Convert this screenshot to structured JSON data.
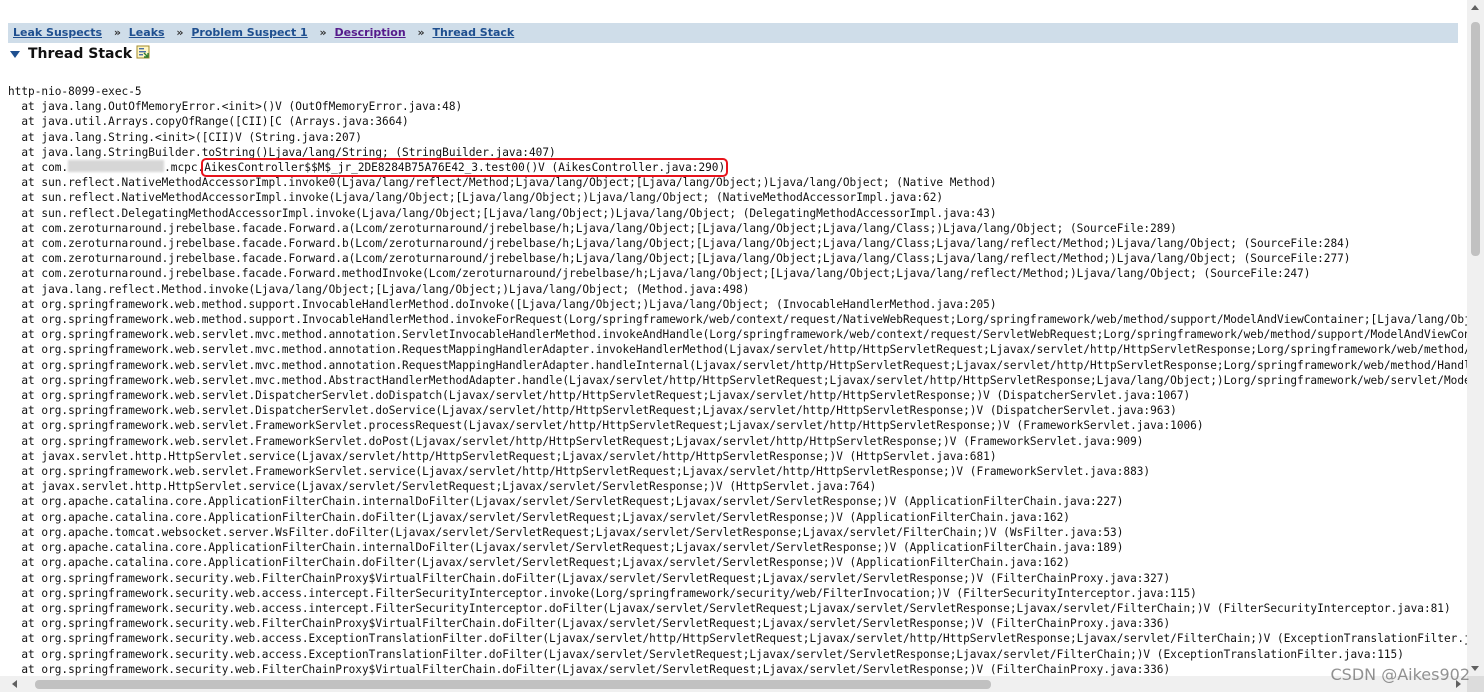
{
  "breadcrumb": {
    "items": [
      "Leak Suspects",
      "Leaks",
      "Problem Suspect 1",
      "Description",
      "Thread Stack"
    ],
    "separator": "»"
  },
  "section": {
    "title": "Thread Stack",
    "toggle_icon": "triangle-down-icon",
    "copy_icon": "copy-icon"
  },
  "stack": {
    "thread_name": "http-nio-8099-exec-5",
    "frames_before_highlight": [
      "  at java.lang.OutOfMemoryError.<init>()V (OutOfMemoryError.java:48)",
      "  at java.util.Arrays.copyOfRange([CII)[C (Arrays.java:3664)",
      "  at java.lang.String.<init>([CII)V (String.java:207)",
      "  at java.lang.StringBuilder.toString()Ljava/lang/String; (StringBuilder.java:407)"
    ],
    "highlight_prefix": "  at com.",
    "highlight_middle": ".mcpc.",
    "highlight_text": "AikesController$$M$_jr_2DE8284B75A76E42_3.test00()V (AikesController.java:290)",
    "frames_after_highlight": [
      "  at sun.reflect.NativeMethodAccessorImpl.invoke0(Ljava/lang/reflect/Method;Ljava/lang/Object;[Ljava/lang/Object;)Ljava/lang/Object; (Native Method)",
      "  at sun.reflect.NativeMethodAccessorImpl.invoke(Ljava/lang/Object;[Ljava/lang/Object;)Ljava/lang/Object; (NativeMethodAccessorImpl.java:62)",
      "  at sun.reflect.DelegatingMethodAccessorImpl.invoke(Ljava/lang/Object;[Ljava/lang/Object;)Ljava/lang/Object; (DelegatingMethodAccessorImpl.java:43)",
      "  at com.zeroturnaround.jrebelbase.facade.Forward.a(Lcom/zeroturnaround/jrebelbase/h;Ljava/lang/Object;[Ljava/lang/Object;Ljava/lang/Class;)Ljava/lang/Object; (SourceFile:289)",
      "  at com.zeroturnaround.jrebelbase.facade.Forward.b(Lcom/zeroturnaround/jrebelbase/h;Ljava/lang/Object;[Ljava/lang/Object;Ljava/lang/Class;Ljava/lang/reflect/Method;)Ljava/lang/Object; (SourceFile:284)",
      "  at com.zeroturnaround.jrebelbase.facade.Forward.a(Lcom/zeroturnaround/jrebelbase/h;Ljava/lang/Object;[Ljava/lang/Object;Ljava/lang/Class;Ljava/lang/reflect/Method;)Ljava/lang/Object; (SourceFile:277)",
      "  at com.zeroturnaround.jrebelbase.facade.Forward.methodInvoke(Lcom/zeroturnaround/jrebelbase/h;Ljava/lang/Object;[Ljava/lang/Object;Ljava/lang/reflect/Method;)Ljava/lang/Object; (SourceFile:247)",
      "  at java.lang.reflect.Method.invoke(Ljava/lang/Object;[Ljava/lang/Object;)Ljava/lang/Object; (Method.java:498)",
      "  at org.springframework.web.method.support.InvocableHandlerMethod.doInvoke([Ljava/lang/Object;)Ljava/lang/Object; (InvocableHandlerMethod.java:205)",
      "  at org.springframework.web.method.support.InvocableHandlerMethod.invokeForRequest(Lorg/springframework/web/context/request/NativeWebRequest;Lorg/springframework/web/method/support/ModelAndViewContainer;[Ljava/lang/Obj",
      "  at org.springframework.web.servlet.mvc.method.annotation.ServletInvocableHandlerMethod.invokeAndHandle(Lorg/springframework/web/context/request/ServletWebRequest;Lorg/springframework/web/method/support/ModelAndViewCon",
      "  at org.springframework.web.servlet.mvc.method.annotation.RequestMappingHandlerAdapter.invokeHandlerMethod(Ljavax/servlet/http/HttpServletRequest;Ljavax/servlet/http/HttpServletResponse;Lorg/springframework/web/method/",
      "  at org.springframework.web.servlet.mvc.method.annotation.RequestMappingHandlerAdapter.handleInternal(Ljavax/servlet/http/HttpServletRequest;Ljavax/servlet/http/HttpServletResponse;Lorg/springframework/web/method/Handl",
      "  at org.springframework.web.servlet.mvc.method.AbstractHandlerMethodAdapter.handle(Ljavax/servlet/http/HttpServletRequest;Ljavax/servlet/http/HttpServletResponse;Ljava/lang/Object;)Lorg/springframework/web/servlet/Mode",
      "  at org.springframework.web.servlet.DispatcherServlet.doDispatch(Ljavax/servlet/http/HttpServletRequest;Ljavax/servlet/http/HttpServletResponse;)V (DispatcherServlet.java:1067)",
      "  at org.springframework.web.servlet.DispatcherServlet.doService(Ljavax/servlet/http/HttpServletRequest;Ljavax/servlet/http/HttpServletResponse;)V (DispatcherServlet.java:963)",
      "  at org.springframework.web.servlet.FrameworkServlet.processRequest(Ljavax/servlet/http/HttpServletRequest;Ljavax/servlet/http/HttpServletResponse;)V (FrameworkServlet.java:1006)",
      "  at org.springframework.web.servlet.FrameworkServlet.doPost(Ljavax/servlet/http/HttpServletRequest;Ljavax/servlet/http/HttpServletResponse;)V (FrameworkServlet.java:909)",
      "  at javax.servlet.http.HttpServlet.service(Ljavax/servlet/http/HttpServletRequest;Ljavax/servlet/http/HttpServletResponse;)V (HttpServlet.java:681)",
      "  at org.springframework.web.servlet.FrameworkServlet.service(Ljavax/servlet/http/HttpServletRequest;Ljavax/servlet/http/HttpServletResponse;)V (FrameworkServlet.java:883)",
      "  at javax.servlet.http.HttpServlet.service(Ljavax/servlet/ServletRequest;Ljavax/servlet/ServletResponse;)V (HttpServlet.java:764)",
      "  at org.apache.catalina.core.ApplicationFilterChain.internalDoFilter(Ljavax/servlet/ServletRequest;Ljavax/servlet/ServletResponse;)V (ApplicationFilterChain.java:227)",
      "  at org.apache.catalina.core.ApplicationFilterChain.doFilter(Ljavax/servlet/ServletRequest;Ljavax/servlet/ServletResponse;)V (ApplicationFilterChain.java:162)",
      "  at org.apache.tomcat.websocket.server.WsFilter.doFilter(Ljavax/servlet/ServletRequest;Ljavax/servlet/ServletResponse;Ljavax/servlet/FilterChain;)V (WsFilter.java:53)",
      "  at org.apache.catalina.core.ApplicationFilterChain.internalDoFilter(Ljavax/servlet/ServletRequest;Ljavax/servlet/ServletResponse;)V (ApplicationFilterChain.java:189)",
      "  at org.apache.catalina.core.ApplicationFilterChain.doFilter(Ljavax/servlet/ServletRequest;Ljavax/servlet/ServletResponse;)V (ApplicationFilterChain.java:162)",
      "  at org.springframework.security.web.FilterChainProxy$VirtualFilterChain.doFilter(Ljavax/servlet/ServletRequest;Ljavax/servlet/ServletResponse;)V (FilterChainProxy.java:327)",
      "  at org.springframework.security.web.access.intercept.FilterSecurityInterceptor.invoke(Lorg/springframework/security/web/FilterInvocation;)V (FilterSecurityInterceptor.java:115)",
      "  at org.springframework.security.web.access.intercept.FilterSecurityInterceptor.doFilter(Ljavax/servlet/ServletRequest;Ljavax/servlet/ServletResponse;Ljavax/servlet/FilterChain;)V (FilterSecurityInterceptor.java:81)",
      "  at org.springframework.security.web.FilterChainProxy$VirtualFilterChain.doFilter(Ljavax/servlet/ServletRequest;Ljavax/servlet/ServletResponse;)V (FilterChainProxy.java:336)",
      "  at org.springframework.security.web.access.ExceptionTranslationFilter.doFilter(Ljavax/servlet/http/HttpServletRequest;Ljavax/servlet/http/HttpServletResponse;Ljavax/servlet/FilterChain;)V (ExceptionTranslationFilter.j",
      "  at org.springframework.security.web.access.ExceptionTranslationFilter.doFilter(Ljavax/servlet/ServletRequest;Ljavax/servlet/ServletResponse;Ljavax/servlet/FilterChain;)V (ExceptionTranslationFilter.java:115)",
      "  at org.springframework.security.web.FilterChainProxy$VirtualFilterChain.doFilter(Ljavax/servlet/ServletRequest;Ljavax/servlet/ServletResponse;)V (FilterChainProxy.java:336)"
    ]
  },
  "watermark": "CSDN @Aikes902",
  "colors": {
    "breadcrumb_bg": "#cfdde9",
    "link": "#1f4f8f",
    "visited_link": "#551a8b",
    "highlight_border": "#e8141c",
    "scrollbar_track": "#f0f0f0",
    "scrollbar_thumb": "#c1c1c1"
  }
}
